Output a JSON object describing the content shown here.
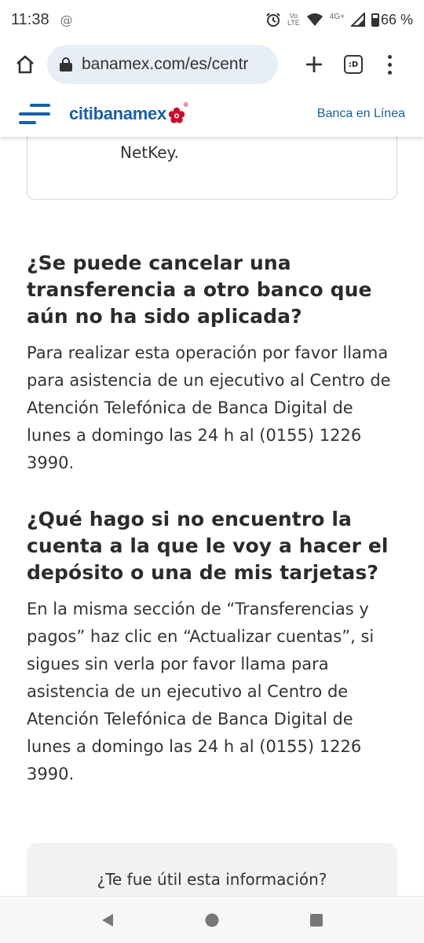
{
  "status_bar": {
    "time": "11:38",
    "at_symbol": "@",
    "volte_top": "Vo",
    "volte_bottom": "LTE",
    "network": "4G+",
    "battery": "66 %"
  },
  "browser": {
    "url": "banamex.com/es/centr",
    "tab_count": ":D"
  },
  "site_header": {
    "logo_citi": "citi",
    "logo_banamex": "banamex",
    "logo_reg": "®",
    "banca_link": "Banca en Línea"
  },
  "previous_card": {
    "text": "NetKey."
  },
  "faqs": [
    {
      "question": "¿Se puede cancelar una transferencia a otro banco que aún no ha sido aplicada?",
      "answer": "Para realizar esta operación por favor llama para asistencia de un ejecutivo al Centro de Atención Telefónica de Banca Digital de lunes a domingo las 24 h al (0155) 1226 3990."
    },
    {
      "question": "¿Qué hago si no encuentro la cuenta a la que le voy a hacer el depósito o una de mis tarjetas?",
      "answer": "En la misma sección de “Transferencias y pagos” haz clic en “Actualizar cuentas”, si sigues sin verla por favor llama para asistencia de un ejecutivo al Centro de Atención Telefónica de Banca Digital de lunes a domingo las 24 h al (0155) 1226 3990."
    }
  ],
  "feedback": {
    "question": "¿Te fue útil esta información?"
  },
  "colors": {
    "brand_blue": "#1a5fa6",
    "brand_red": "#c8102e"
  }
}
